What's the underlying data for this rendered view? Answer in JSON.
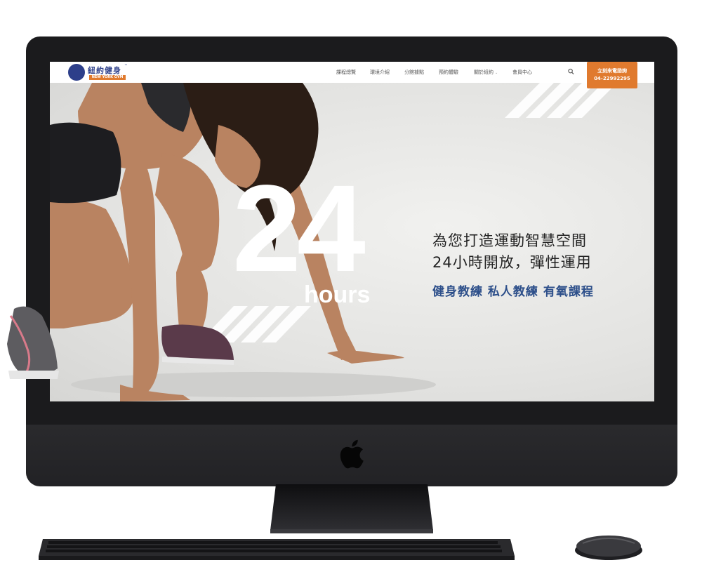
{
  "site": {
    "logo": {
      "name_cn": "紐約健身",
      "name_en": "NEW YORK GYM",
      "trademark": "™"
    },
    "nav": {
      "items": [
        {
          "label": "課程總覽",
          "has_dropdown": false
        },
        {
          "label": "環境介紹",
          "has_dropdown": false
        },
        {
          "label": "分館據點",
          "has_dropdown": false
        },
        {
          "label": "預約體驗",
          "has_dropdown": false
        },
        {
          "label": "關於紐約",
          "has_dropdown": true
        },
        {
          "label": "會員中心",
          "has_dropdown": false
        }
      ],
      "dropdown_glyph": "⌄",
      "search_icon": "search-icon"
    },
    "cta": {
      "line1": "立刻來電諮詢",
      "line2": "04-22992295",
      "color": "#e07a2e"
    }
  },
  "hero": {
    "big_number": "24",
    "big_unit": "hours",
    "headline": [
      "為您打造運動智慧空間",
      "24小時開放，彈性運用"
    ],
    "subline": "健身教練 私人教練 有氧課程",
    "subline_color": "#2d4f8a"
  },
  "device": {
    "type": "imac",
    "accessories": [
      "keyboard",
      "mouse"
    ],
    "icons": [
      "apple-logo-icon"
    ]
  },
  "colors": {
    "brand_blue": "#2d3f8a",
    "brand_orange": "#e07a2e"
  }
}
